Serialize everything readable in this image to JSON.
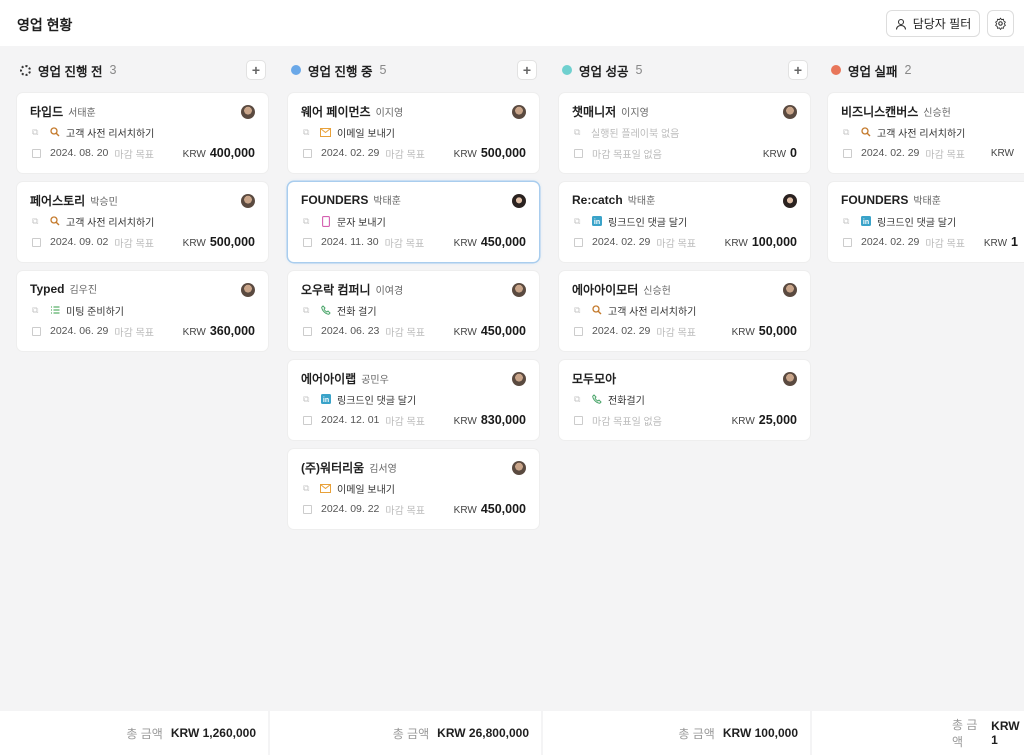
{
  "header": {
    "title": "영업 현황",
    "filter_label": "담당자 필터",
    "filter_icon": "user-icon",
    "settings_icon": "gear-icon"
  },
  "footer_label": "총 금액",
  "columns": [
    {
      "title": "영업 진행 전",
      "count": "3",
      "status_icon": "spinner-icon",
      "color": "#333333",
      "total": "KRW 1,260,000",
      "cards": [
        {
          "company": "타입드",
          "owner": "서태훈",
          "activity_icon": "search-icon",
          "activity": "고객 사전 리서치하기",
          "date": "2024. 08. 20",
          "date_label": "마감 목표",
          "currency": "KRW",
          "amount": "400,000"
        },
        {
          "company": "페어스토리",
          "owner": "박승민",
          "activity_icon": "search-icon",
          "activity": "고객 사전 리서치하기",
          "date": "2024. 09. 02",
          "date_label": "마감 목표",
          "currency": "KRW",
          "amount": "500,000"
        },
        {
          "company": "Typed",
          "owner": "김우진",
          "activity_icon": "list-icon",
          "activity": "미팅 준비하기",
          "date": "2024. 06. 29",
          "date_label": "마감 목표",
          "currency": "KRW",
          "amount": "360,000"
        }
      ]
    },
    {
      "title": "영업 진행 중",
      "count": "5",
      "status_icon": "dot-icon",
      "color": "#6aa8e8",
      "total": "KRW 26,800,000",
      "cards": [
        {
          "company": "웨어 페이먼츠",
          "owner": "이지영",
          "activity_icon": "mail-icon",
          "activity": "이메일 보내기",
          "date": "2024. 02. 29",
          "date_label": "마감 목표",
          "currency": "KRW",
          "amount": "500,000"
        },
        {
          "company": "FOUNDERS",
          "owner": "박태훈",
          "activity_icon": "phone-message-icon",
          "activity": "문자 보내기",
          "date": "2024. 11. 30",
          "date_label": "마감 목표",
          "currency": "KRW",
          "amount": "450,000",
          "selected": true
        },
        {
          "company": "오우락 컴퍼니",
          "owner": "이여경",
          "activity_icon": "phone-icon",
          "activity": "전화 걸기",
          "date": "2024. 06. 23",
          "date_label": "마감 목표",
          "currency": "KRW",
          "amount": "450,000"
        },
        {
          "company": "에어아이랩",
          "owner": "공민우",
          "activity_icon": "linkedin-icon",
          "activity": "링크드인 댓글 달기",
          "date": "2024. 12. 01",
          "date_label": "마감 목표",
          "currency": "KRW",
          "amount": "830,000"
        },
        {
          "company": "(주)워터리움",
          "owner": "김서영",
          "activity_icon": "mail-icon",
          "activity": "이메일 보내기",
          "date": "2024. 09. 22",
          "date_label": "마감 목표",
          "currency": "KRW",
          "amount": "450,000"
        }
      ]
    },
    {
      "title": "영업 성공",
      "count": "5",
      "status_icon": "dot-icon",
      "color": "#6fd0cf",
      "total": "KRW 100,000",
      "cards": [
        {
          "company": "챗매니저",
          "owner": "이지영",
          "activity_icon": "",
          "activity": "실행된 플레이북 없음",
          "activity_muted": true,
          "date": "",
          "date_label": "마감 목표일 없음",
          "currency": "KRW",
          "amount": "0"
        },
        {
          "company": "Re:catch",
          "owner": "박태훈",
          "activity_icon": "linkedin-icon",
          "activity": "링크드인 댓글 달기",
          "date": "2024. 02. 29",
          "date_label": "마감 목표",
          "currency": "KRW",
          "amount": "100,000"
        },
        {
          "company": "에아아이모터",
          "owner": "신승헌",
          "activity_icon": "search-icon",
          "activity": "고객 사전 리서치하기",
          "date": "2024. 02. 29",
          "date_label": "마감 목표",
          "currency": "KRW",
          "amount": "50,000"
        },
        {
          "company": "모두모아",
          "owner": "",
          "activity_icon": "phone-icon",
          "activity": "전화걸기",
          "date": "",
          "date_label": "마감 목표일 없음",
          "currency": "KRW",
          "amount": "25,000"
        }
      ]
    },
    {
      "title": "영업 실패",
      "count": "2",
      "status_icon": "dot-icon",
      "color": "#e8765a",
      "total": "KRW 1",
      "cards": [
        {
          "company": "비즈니스캔버스",
          "owner": "신승헌",
          "activity_icon": "search-icon",
          "activity": "고객 사전 리서치하기",
          "date": "2024. 02. 29",
          "date_label": "마감 목표",
          "currency": "KRW",
          "amount": ""
        },
        {
          "company": "FOUNDERS",
          "owner": "박태훈",
          "activity_icon": "linkedin-icon",
          "activity": "링크드인 댓글 달기",
          "date": "2024. 02. 29",
          "date_label": "마감 목표",
          "currency": "KRW",
          "amount": "1"
        }
      ]
    }
  ]
}
